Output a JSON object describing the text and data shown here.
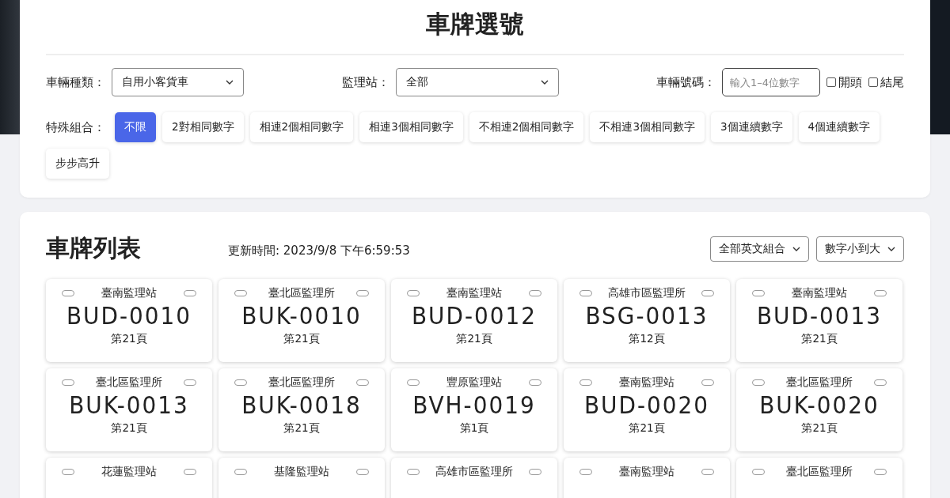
{
  "filter_panel": {
    "title": "車牌選號",
    "vehicle_type": {
      "label": "車輛種類：",
      "value": "自用小客貨車"
    },
    "station": {
      "label": "監理站：",
      "value": "全部"
    },
    "number": {
      "label": "車輛號碼：",
      "placeholder": "輸入1–4位數字"
    },
    "position_options": [
      {
        "label": "開頭",
        "checked": false
      },
      {
        "label": "結尾",
        "checked": false
      }
    ],
    "combo_label": "特殊組合：",
    "combos": [
      {
        "label": "不限",
        "selected": true
      },
      {
        "label": "2對相同數字",
        "selected": false
      },
      {
        "label": "相連2個相同數字",
        "selected": false
      },
      {
        "label": "相連3個相同數字",
        "selected": false
      },
      {
        "label": "不相連2個相同數字",
        "selected": false
      },
      {
        "label": "不相連3個相同數字",
        "selected": false
      },
      {
        "label": "3個連續數字",
        "selected": false
      },
      {
        "label": "4個連續數字",
        "selected": false
      },
      {
        "label": "步步高升",
        "selected": false
      }
    ]
  },
  "plate_list": {
    "title": "車牌列表",
    "updated": "更新時間: 2023/9/8 下午6:59:53",
    "letter_filter": "全部英文組合",
    "sort": "數字小到大",
    "plates": [
      {
        "station": "臺南監理站",
        "number": "BUD-0010",
        "page": "第21頁"
      },
      {
        "station": "臺北區監理所",
        "number": "BUK-0010",
        "page": "第21頁"
      },
      {
        "station": "臺南監理站",
        "number": "BUD-0012",
        "page": "第21頁"
      },
      {
        "station": "高雄市區監理所",
        "number": "BSG-0013",
        "page": "第12頁"
      },
      {
        "station": "臺南監理站",
        "number": "BUD-0013",
        "page": "第21頁"
      },
      {
        "station": "臺北區監理所",
        "number": "BUK-0013",
        "page": "第21頁"
      },
      {
        "station": "臺北區監理所",
        "number": "BUK-0018",
        "page": "第21頁"
      },
      {
        "station": "豐原監理站",
        "number": "BVH-0019",
        "page": "第1頁"
      },
      {
        "station": "臺南監理站",
        "number": "BUD-0020",
        "page": "第21頁"
      },
      {
        "station": "臺北區監理所",
        "number": "BUK-0020",
        "page": "第21頁"
      },
      {
        "station": "花蓮監理站"
      },
      {
        "station": "基隆監理站"
      },
      {
        "station": "高雄市區監理所"
      },
      {
        "station": "臺南監理站"
      },
      {
        "station": "臺北區監理所"
      }
    ]
  }
}
